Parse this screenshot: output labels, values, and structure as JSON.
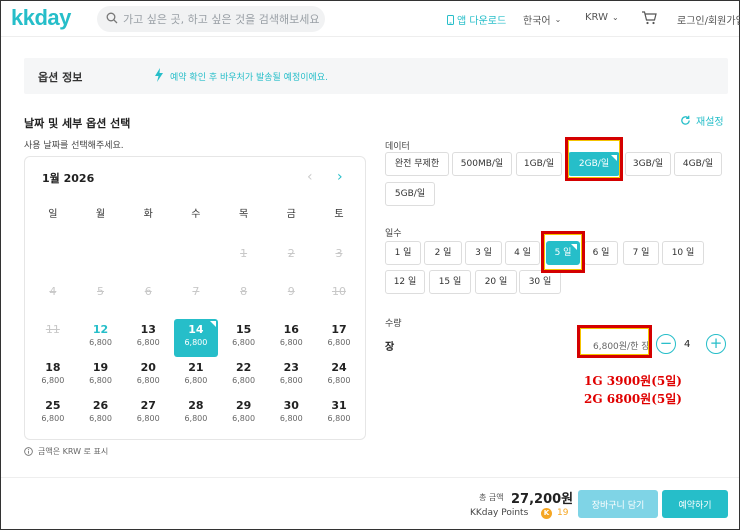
{
  "header": {
    "logo": "kkday",
    "search_placeholder": "가고 싶은 곳, 하고 싶은 것을 검색해보세요.",
    "app_download": "앱 다운로드",
    "language": "한국어",
    "currency": "KRW",
    "login": "로그인/회원가입"
  },
  "option_info": {
    "title": "옵션 정보",
    "message": "예약 확인 후 바우처가 발송될 예정이에요."
  },
  "selection": {
    "title": "날짜 및 세부 옵션 선택",
    "subtitle": "사용 날짜를 선택해주세요.",
    "reset": "재설정"
  },
  "calendar": {
    "month": "1월 2026",
    "weekdays": [
      "일",
      "월",
      "화",
      "수",
      "목",
      "금",
      "토"
    ],
    "days": [
      {
        "n": "",
        "p": "",
        "s": "empty"
      },
      {
        "n": "",
        "p": "",
        "s": "empty"
      },
      {
        "n": "",
        "p": "",
        "s": "empty"
      },
      {
        "n": "",
        "p": "",
        "s": "empty"
      },
      {
        "n": "1",
        "p": "",
        "s": "past"
      },
      {
        "n": "2",
        "p": "",
        "s": "past"
      },
      {
        "n": "3",
        "p": "",
        "s": "past"
      },
      {
        "n": "4",
        "p": "",
        "s": "past"
      },
      {
        "n": "5",
        "p": "",
        "s": "past"
      },
      {
        "n": "6",
        "p": "",
        "s": "past"
      },
      {
        "n": "7",
        "p": "",
        "s": "past"
      },
      {
        "n": "8",
        "p": "",
        "s": "past"
      },
      {
        "n": "9",
        "p": "",
        "s": "past"
      },
      {
        "n": "10",
        "p": "",
        "s": "past"
      },
      {
        "n": "11",
        "p": "",
        "s": "past"
      },
      {
        "n": "12",
        "p": "6,800",
        "s": "today"
      },
      {
        "n": "13",
        "p": "6,800",
        "s": "avail"
      },
      {
        "n": "14",
        "p": "6,800",
        "s": "selected"
      },
      {
        "n": "15",
        "p": "6,800",
        "s": "avail"
      },
      {
        "n": "16",
        "p": "6,800",
        "s": "avail"
      },
      {
        "n": "17",
        "p": "6,800",
        "s": "avail"
      },
      {
        "n": "18",
        "p": "6,800",
        "s": "avail"
      },
      {
        "n": "19",
        "p": "6,800",
        "s": "avail"
      },
      {
        "n": "20",
        "p": "6,800",
        "s": "avail"
      },
      {
        "n": "21",
        "p": "6,800",
        "s": "avail"
      },
      {
        "n": "22",
        "p": "6,800",
        "s": "avail"
      },
      {
        "n": "23",
        "p": "6,800",
        "s": "avail"
      },
      {
        "n": "24",
        "p": "6,800",
        "s": "avail"
      },
      {
        "n": "25",
        "p": "6,800",
        "s": "avail"
      },
      {
        "n": "26",
        "p": "6,800",
        "s": "avail"
      },
      {
        "n": "27",
        "p": "6,800",
        "s": "avail"
      },
      {
        "n": "28",
        "p": "6,800",
        "s": "avail"
      },
      {
        "n": "29",
        "p": "6,800",
        "s": "avail"
      },
      {
        "n": "30",
        "p": "6,800",
        "s": "avail"
      },
      {
        "n": "31",
        "p": "6,800",
        "s": "avail"
      }
    ],
    "note": "금액은 KRW 로 표시"
  },
  "data_option": {
    "label": "데이터",
    "chips": [
      "완전 무제한",
      "500MB/일",
      "1GB/일",
      "2GB/일",
      "3GB/일",
      "4GB/일",
      "5GB/일"
    ],
    "selected": "2GB/일"
  },
  "days_option": {
    "label": "일수",
    "chips": [
      "1 일",
      "2 일",
      "3 일",
      "4 일",
      "5 일",
      "6 일",
      "7 일",
      "10 일",
      "12 일",
      "15 일",
      "20 일",
      "30 일"
    ],
    "selected": "5 일"
  },
  "quantity": {
    "label": "수량",
    "unit": "장",
    "price": "6,800원/한 장",
    "minus": "−",
    "value": "4",
    "plus": "+"
  },
  "annotation": {
    "line1": "1G  3900원(5일)",
    "line2": "2G  6800원(5일)"
  },
  "footer": {
    "total_label": "총 금액",
    "total_amount": "27,200원",
    "points_label": "KKday Points",
    "points_coin": "K",
    "points_value": "19",
    "cart_button": "장바구니 담기",
    "book_button": "예약하기"
  },
  "colors": {
    "accent": "#26bec9",
    "highlight_border": "#d40000",
    "annotation_text": "#e00000"
  }
}
